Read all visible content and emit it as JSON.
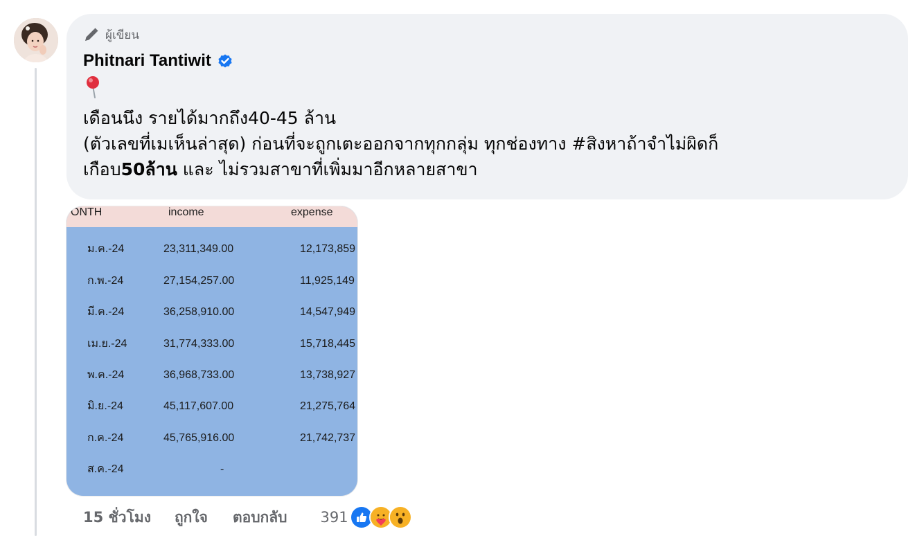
{
  "comment": {
    "author_badge_label": "ผู้เขียน",
    "author_name": "Phitnari Tantiwit",
    "pin_emoji": "📍",
    "text_line1": "เดือนนึง รายได้มากถึง40-45 ล้าน",
    "text_line2": "(ตัวเลขที่เมเห็นล่าสุด) ก่อนที่จะถูกเตะออกจากทุกกลุ่ม ทุกช่องทาง #สิงหาถ้าจำไม่ผิดก็",
    "text_line3_start": "เกือบ",
    "text_line3_bold": "50ล้าน",
    "text_line3_end": " และ ไม่รวมสาขาที่เพิ่มมาอีกหลายสาขา"
  },
  "attachment": {
    "headers": {
      "month": "ONTH",
      "income": "income",
      "expense": "expense"
    },
    "rows": [
      {
        "month": "ม.ค.-24",
        "income": "23,311,349.00",
        "expense": "12,173,859"
      },
      {
        "month": "ก.พ.-24",
        "income": "27,154,257.00",
        "expense": "11,925,149"
      },
      {
        "month": "มี.ค.-24",
        "income": "36,258,910.00",
        "expense": "14,547,949"
      },
      {
        "month": "เม.ย.-24",
        "income": "31,774,333.00",
        "expense": "15,718,445"
      },
      {
        "month": "พ.ค.-24",
        "income": "36,968,733.00",
        "expense": "13,738,927"
      },
      {
        "month": "มิ.ย.-24",
        "income": "45,117,607.00",
        "expense": "21,275,764"
      },
      {
        "month": "ก.ค.-24",
        "income": "45,765,916.00",
        "expense": "21,742,737"
      },
      {
        "month": "ส.ค.-24",
        "income": "-",
        "expense": ""
      }
    ]
  },
  "actions": {
    "time": "15 ชั่วโมง",
    "like_label": "ถูกใจ",
    "reply_label": "ตอบกลับ",
    "reaction_count": "391"
  },
  "icons": {
    "author_badge": "pencil-icon",
    "verified": "verified-badge-icon",
    "reactions": [
      "like-reaction-icon",
      "care-reaction-icon",
      "wow-reaction-icon"
    ]
  },
  "colors": {
    "bubble_bg": "#f0f2f5",
    "verified_blue": "#1877f2",
    "secondary_text": "#65676b",
    "sheet_header_bg": "#f3dbd8",
    "sheet_body_bg": "#8fb4e3"
  }
}
